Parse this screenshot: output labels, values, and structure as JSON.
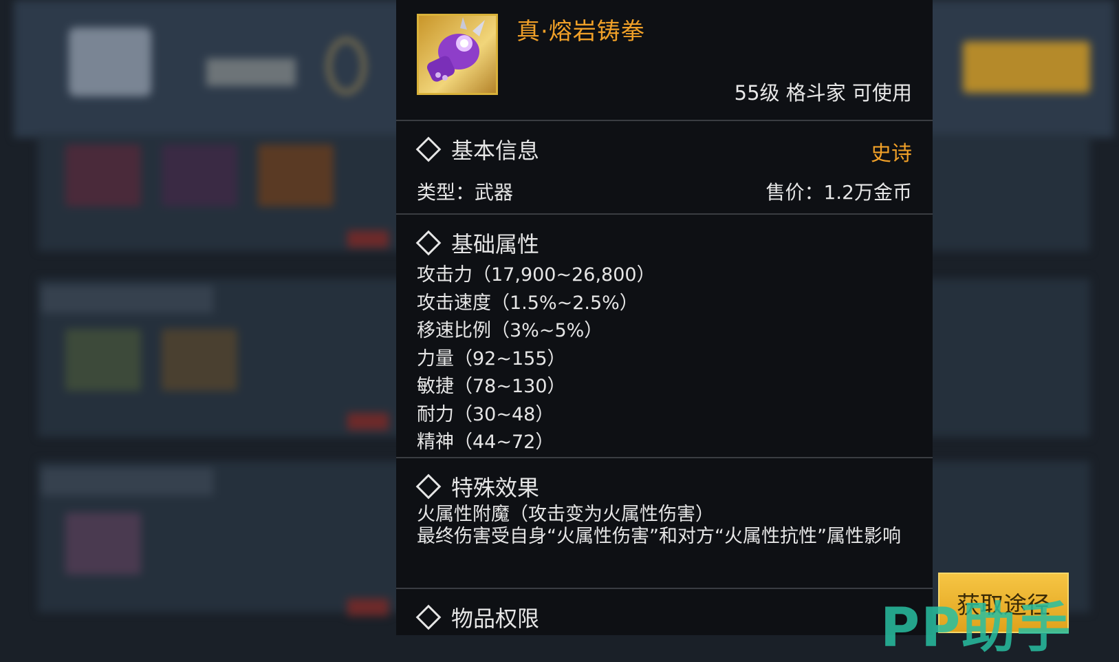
{
  "item": {
    "name": "真·熔岩铸拳",
    "requirement": "55级 格斗家 可使用",
    "icon": "purple-gauntlet-icon"
  },
  "basic_info": {
    "title": "基本信息",
    "rarity": "史诗",
    "rarity_color": "#f0a028",
    "type": "类型：武器",
    "price": "售价：1.2万金币"
  },
  "base_attrs": {
    "title": "基础属性",
    "items": [
      "攻击力（17,900~26,800）",
      "攻击速度（1.5%~2.5%）",
      "移速比例（3%~5%）",
      "力量（92~155）",
      "敏捷（78~130）",
      "耐力（30~48）",
      "精神（44~72）"
    ]
  },
  "special_effect": {
    "title": "特殊效果",
    "line1": "火属性附魔（攻击变为火属性伤害）",
    "line2": "最终伤害受自身“火属性伤害”和对方“火属性抗性”属性影响"
  },
  "permission": {
    "title": "物品权限"
  },
  "actions": {
    "get_route": "获取途径"
  },
  "watermark": "PP助手"
}
